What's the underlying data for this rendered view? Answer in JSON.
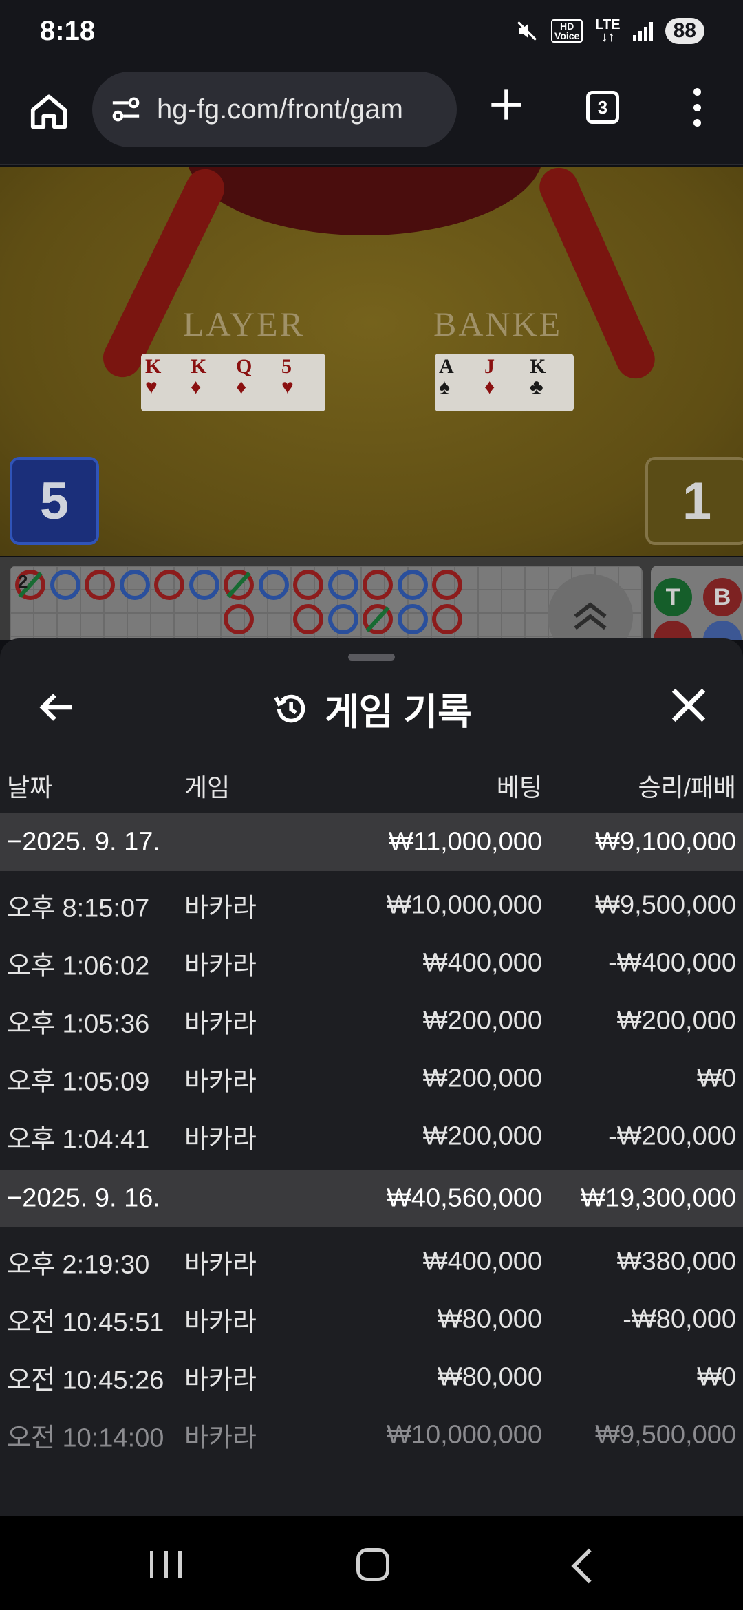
{
  "status_bar": {
    "time": "8:18",
    "icons": [
      "mute-icon",
      "hd-voice-icon",
      "lte-icon",
      "signal-icon"
    ],
    "hd_line1": "HD",
    "hd_line2": "Voice",
    "network": "LTE",
    "battery": "88"
  },
  "browser": {
    "url": "hg-fg.com/front/gam",
    "tab_count": "3"
  },
  "game": {
    "player_label": "LAYER",
    "banker_label": "BANKE",
    "player_cards": [
      {
        "rank": "K",
        "suit": "♥",
        "color": "red"
      },
      {
        "rank": "K",
        "suit": "♦",
        "color": "red"
      },
      {
        "rank": "Q",
        "suit": "♦",
        "color": "red"
      },
      {
        "rank": "5",
        "suit": "♥",
        "color": "red"
      }
    ],
    "banker_cards": [
      {
        "rank": "A",
        "suit": "♠",
        "color": "black"
      },
      {
        "rank": "J",
        "suit": "♦",
        "color": "red"
      },
      {
        "rank": "K",
        "suit": "♣",
        "color": "black"
      }
    ],
    "player_score": "5",
    "banker_score": "1",
    "road_first_badge": "2",
    "side_tie": "T",
    "side_banker": "B"
  },
  "sheet": {
    "title": "게임 기록",
    "columns": {
      "date": "날짜",
      "game": "게임",
      "bet": "베팅",
      "result": "승리/패배"
    },
    "days": [
      {
        "date": "−2025. 9. 17.",
        "bet": "₩11,000,000",
        "result": "₩9,100,000",
        "rows": [
          {
            "time": "오후 8:15:07",
            "game": "바카라",
            "bet": "₩10,000,000",
            "result": "₩9,500,000"
          },
          {
            "time": "오후 1:06:02",
            "game": "바카라",
            "bet": "₩400,000",
            "result": "-₩400,000"
          },
          {
            "time": "오후 1:05:36",
            "game": "바카라",
            "bet": "₩200,000",
            "result": "₩200,000"
          },
          {
            "time": "오후 1:05:09",
            "game": "바카라",
            "bet": "₩200,000",
            "result": "₩0"
          },
          {
            "time": "오후 1:04:41",
            "game": "바카라",
            "bet": "₩200,000",
            "result": "-₩200,000"
          }
        ]
      },
      {
        "date": "−2025. 9. 16.",
        "bet": "₩40,560,000",
        "result": "₩19,300,000",
        "rows": [
          {
            "time": "오후 2:19:30",
            "game": "바카라",
            "bet": "₩400,000",
            "result": "₩380,000"
          },
          {
            "time": "오전 10:45:51",
            "game": "바카라",
            "bet": "₩80,000",
            "result": "-₩80,000"
          },
          {
            "time": "오전 10:45:26",
            "game": "바카라",
            "bet": "₩80,000",
            "result": "₩0"
          },
          {
            "time": "오전 10:14:00",
            "game": "바카라",
            "bet": "₩10,000,000",
            "result": "₩9,500,000"
          }
        ]
      }
    ]
  }
}
